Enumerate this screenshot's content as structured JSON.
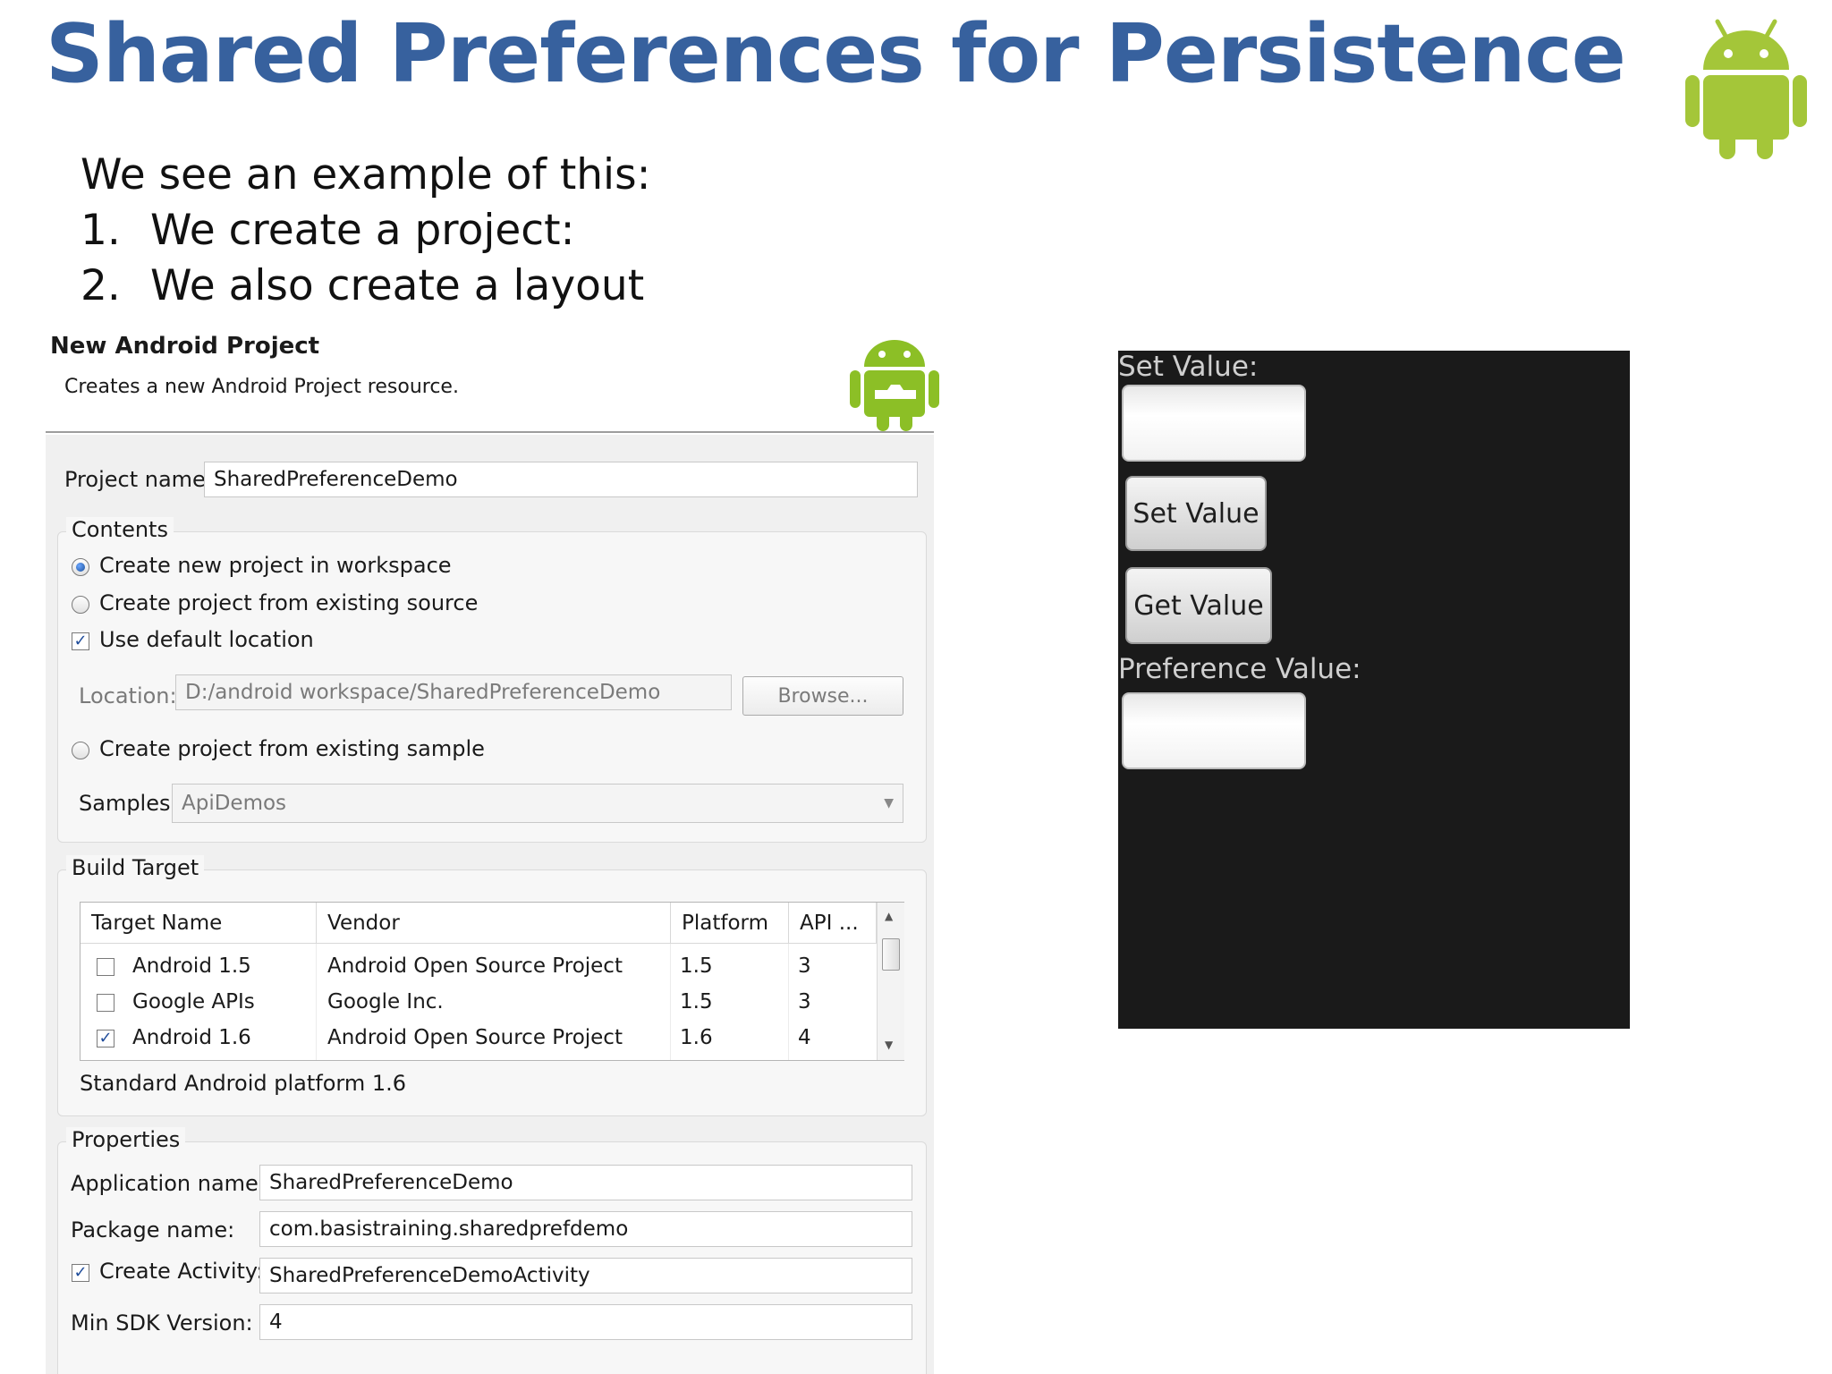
{
  "slide": {
    "title": "Shared Preferences for Persistence",
    "intro": "We see an example of this:",
    "steps": [
      {
        "num": "1.",
        "text": "We create a project:"
      },
      {
        "num": "2.",
        "text": "We also create a layout"
      }
    ],
    "logo_icon": "android-robot-icon"
  },
  "dialog": {
    "heading": "New Android Project",
    "subheading": "Creates a new Android Project resource.",
    "header_icon": "android-wizard-icon",
    "project_name_label": "Project name:",
    "project_name_value": "SharedPreferenceDemo",
    "contents": {
      "label": "Contents",
      "radio_new": "Create new project in workspace",
      "radio_existing": "Create project from existing source",
      "use_default": "Use default location",
      "location_label": "Location:",
      "location_value": "D:/android workspace/SharedPreferenceDemo",
      "browse_label": "Browse...",
      "radio_sample": "Create project from existing sample",
      "samples_label": "Samples:",
      "samples_value": "ApiDemos"
    },
    "build_target": {
      "label": "Build Target",
      "columns": [
        "Target Name",
        "Vendor",
        "Platform",
        "API ..."
      ],
      "rows": [
        {
          "checked": false,
          "name": "Android 1.5",
          "vendor": "Android Open Source Project",
          "platform": "1.5",
          "api": "3"
        },
        {
          "checked": false,
          "name": "Google APIs",
          "vendor": "Google Inc.",
          "platform": "1.5",
          "api": "3"
        },
        {
          "checked": true,
          "name": "Android 1.6",
          "vendor": "Android Open Source Project",
          "platform": "1.6",
          "api": "4"
        }
      ],
      "description": "Standard Android platform 1.6"
    },
    "properties": {
      "label": "Properties",
      "app_name_label": "Application name:",
      "app_name_value": "SharedPreferenceDemo",
      "package_label": "Package name:",
      "package_value": "com.basistraining.sharedprefdemo",
      "activity_label": "Create Activity:",
      "activity_value": "SharedPreferenceDemoActivity",
      "min_sdk_label": "Min SDK Version:",
      "min_sdk_value": "4"
    }
  },
  "phone": {
    "set_label": "Set Value:",
    "set_button": "Set Value",
    "get_button": "Get Value",
    "pref_label": "Preference Value:"
  },
  "colors": {
    "title": "#37619e",
    "android_green": "#a4c639",
    "phone_bg": "#1a1a1a"
  }
}
